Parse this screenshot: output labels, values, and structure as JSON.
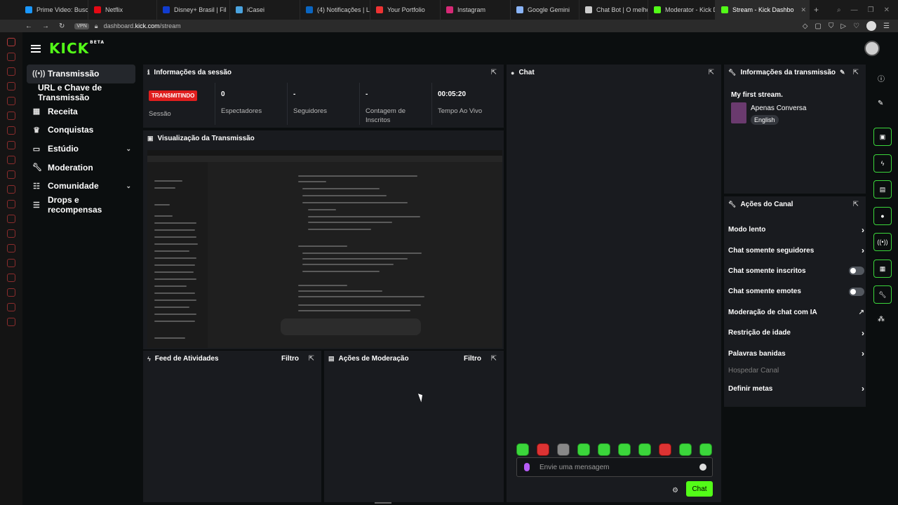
{
  "browser": {
    "tabs": [
      {
        "label": "Prime Video: Busca",
        "color": "#1a98ff"
      },
      {
        "label": "Netflix",
        "color": "#e50914"
      },
      {
        "label": "Disney+ Brasil | Fil",
        "color": "#113ccf"
      },
      {
        "label": "iCasei",
        "color": "#4aa3df"
      },
      {
        "label": "(4) Notificações | L",
        "color": "#0a66c2"
      },
      {
        "label": "Your Portfolio",
        "color": "#e33"
      },
      {
        "label": "Instagram",
        "color": "#d62976"
      },
      {
        "label": "Google Gemini",
        "color": "#8ab4f8"
      },
      {
        "label": "Chat Bot | O melho",
        "color": "#cccccc"
      },
      {
        "label": "Moderator - Kick D",
        "color": "#53fc18"
      },
      {
        "label": "Stream - Kick Dashbo",
        "color": "#53fc18"
      }
    ],
    "vpn": "VPN",
    "url_prefix": "dashboard.",
    "url_domain": "kick.com",
    "url_path": "/stream"
  },
  "brand": {
    "logo": "KICK",
    "beta": "BETA",
    "accent": "#53fc18"
  },
  "nav": {
    "items": [
      {
        "label": "Transmissão",
        "icon": "broadcast-icon"
      },
      {
        "label": "URL e Chave de Transmissão",
        "icon": ""
      },
      {
        "label": "Receita",
        "icon": "revenue-icon"
      },
      {
        "label": "Conquistas",
        "icon": "trophy-icon"
      },
      {
        "label": "Estúdio",
        "icon": "studio-icon"
      },
      {
        "label": "Moderation",
        "icon": "wrench-icon"
      },
      {
        "label": "Comunidade",
        "icon": "community-icon"
      },
      {
        "label": "Drops e recompensas",
        "icon": "drops-icon"
      }
    ]
  },
  "session": {
    "title": "Informações da sessão",
    "live_badge": "TRANSMITINDO",
    "stats": [
      {
        "value": "",
        "label": "Sessão"
      },
      {
        "value": "0",
        "label": "Espectadores"
      },
      {
        "value": "-",
        "label": "Seguidores"
      },
      {
        "value": "-",
        "label": "Contagem de Inscritos"
      },
      {
        "value": "00:05:20",
        "label": "Tempo Ao Vivo"
      }
    ]
  },
  "preview": {
    "title": "Visualização da Transmissão"
  },
  "feed": {
    "title": "Feed de Atividades",
    "filter": "Filtro"
  },
  "modactions": {
    "title": "Ações de Moderação",
    "filter": "Filtro"
  },
  "chat": {
    "title": "Chat",
    "placeholder": "Envie uma mensagem",
    "send": "Chat"
  },
  "stream_info": {
    "title": "Informações da transmissão",
    "stream_title": "My first stream.",
    "category": "Apenas Conversa",
    "language": "English"
  },
  "channel_actions": {
    "title": "Ações do Canal",
    "rows": [
      {
        "label": "Modo lento",
        "kind": "arrow"
      },
      {
        "label": "Chat somente seguidores",
        "kind": "arrow"
      },
      {
        "label": "Chat somente inscritos",
        "kind": "toggle"
      },
      {
        "label": "Chat somente emotes",
        "kind": "toggle"
      },
      {
        "label": "Moderação de chat com IA",
        "kind": "external"
      },
      {
        "label": "Restrição de idade",
        "kind": "arrow"
      },
      {
        "label": "Palavras banidas",
        "kind": "arrow"
      },
      {
        "label": "Hospedar Canal",
        "kind": "muted"
      },
      {
        "label": "Definir metas",
        "kind": "arrow"
      }
    ]
  }
}
